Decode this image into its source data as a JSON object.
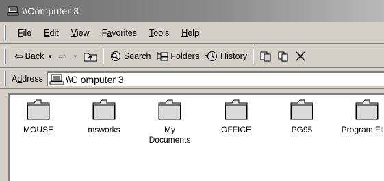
{
  "window": {
    "title": "\\\\Computer 3"
  },
  "menu": {
    "items": [
      {
        "accel": "F",
        "rest": "ile"
      },
      {
        "accel": "E",
        "rest": "dit"
      },
      {
        "accel": "V",
        "rest": "iew"
      },
      {
        "pre": "F",
        "accel": "a",
        "rest": "vorites"
      },
      {
        "accel": "T",
        "rest": "ools"
      },
      {
        "accel": "H",
        "rest": "elp"
      }
    ]
  },
  "toolbar": {
    "back_label": "Back",
    "search_label": "Search",
    "folders_label": "Folders",
    "history_label": "History"
  },
  "address": {
    "label_pre": "A",
    "label_accel": "d",
    "label_rest": "dress",
    "value": "\\\\C omputer 3"
  },
  "folders": [
    {
      "name": "MOUSE"
    },
    {
      "name": "msworks"
    },
    {
      "name": "My Documents"
    },
    {
      "name": "OFFICE"
    },
    {
      "name": "PG95"
    },
    {
      "name": "Program Files"
    }
  ]
}
